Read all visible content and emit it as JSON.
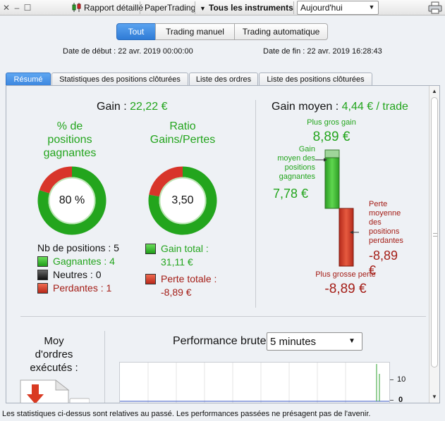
{
  "toolbar": {
    "report_label": "Rapport détaillé",
    "account_label": "PaperTrading",
    "instruments_label": "Tous les instruments",
    "period_value": "Aujourd'hui"
  },
  "mode_tabs": [
    "Tout",
    "Trading manuel",
    "Trading automatique"
  ],
  "dates": {
    "start": "Date de début : 22 avr. 2019 00:00:00",
    "end": "Date de fin : 22 avr. 2019 16:28:43"
  },
  "tabs": [
    "Résumé",
    "Statistiques des positions clôturées",
    "Liste des ordres",
    "Liste des positions clôturées"
  ],
  "gain": {
    "label": "Gain :",
    "value": "22,22 €"
  },
  "win_pct": {
    "title_l1": "% de",
    "title_l2": "positions",
    "title_l3": "gagnantes",
    "value": "80 %",
    "fraction": 0.8
  },
  "ratio": {
    "title_l1": "Ratio",
    "title_l2": "Gains/Pertes",
    "value": "3,50",
    "fraction": 0.778
  },
  "positions": {
    "count_label": "Nb de positions : 5",
    "winning": "Gagnantes : 4",
    "neutral": "Neutres : 0",
    "losing": "Perdantes : 1"
  },
  "totals": {
    "gain_label": "Gain total :",
    "gain_value": "31,11 €",
    "loss_label": "Perte totale :",
    "loss_value": "-8,89 €"
  },
  "avg": {
    "label": "Gain moyen :",
    "value": "4,44 € / trade",
    "max_gain_label": "Plus gros gain",
    "max_gain_value": "8,89 €",
    "avg_win_l1": "Gain",
    "avg_win_l2": "moyen des",
    "avg_win_l3": "positions",
    "avg_win_l4": "gagnantes",
    "avg_win_value": "7,78 €",
    "avg_loss_l1": "Perte",
    "avg_loss_l2": "moyenne",
    "avg_loss_l3": "des",
    "avg_loss_l4": "positions",
    "avg_loss_l5": "perdantes",
    "avg_loss_value_a": "-8,89",
    "avg_loss_value_b": "€",
    "max_loss_label": "Plus grosse perte",
    "max_loss_value": "-8,89 €"
  },
  "orders": {
    "l1": "Moy",
    "l2": "d'ordres",
    "l3": "exécutés :"
  },
  "performance": {
    "label": "Performance brute",
    "interval": "5 minutes",
    "tick_top": "10",
    "tick_bottom": "0"
  },
  "footer": "Les statistiques ci-dessus sont relatives au passé. Les performances passées ne présagent pas de l'avenir.",
  "colors": {
    "green": "#23a51d",
    "red": "#a41d16",
    "accent": "#3b86de"
  }
}
